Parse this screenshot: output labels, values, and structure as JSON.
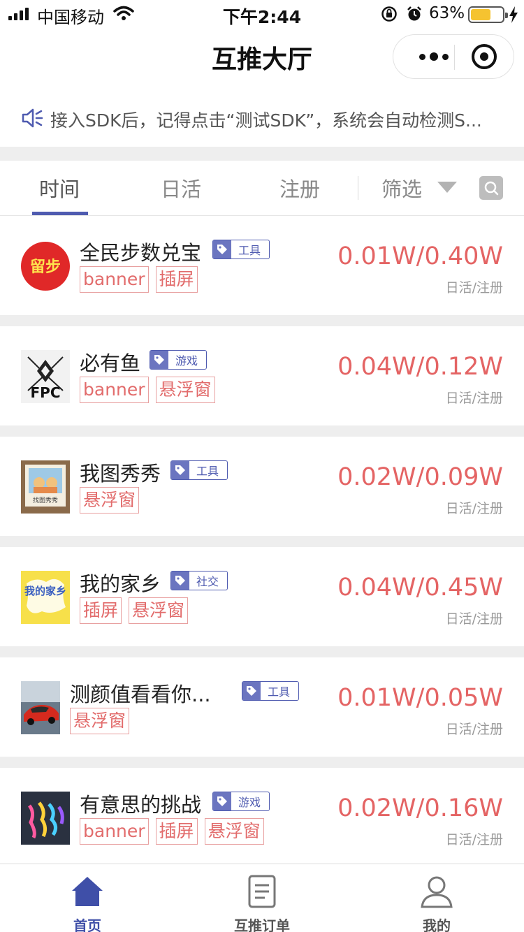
{
  "status_bar": {
    "carrier": "中国移动",
    "time": "下午2:44",
    "battery_percent": "63%",
    "battery_level": 0.63
  },
  "header": {
    "title": "互推大厅"
  },
  "notice": {
    "text": "接入SDK后，记得点击“测试SDK”，系统会自动检测S..."
  },
  "tabs": [
    {
      "label": "时间"
    },
    {
      "label": "日活"
    },
    {
      "label": "注册"
    },
    {
      "label": "筛选"
    }
  ],
  "apps": [
    {
      "name": "全民步数兑宝",
      "category": "工具",
      "tags": [
        "banner",
        "插屏"
      ],
      "stats": "0.01W/0.40W",
      "stats_label": "日活/注册",
      "icon_text": "留步"
    },
    {
      "name": "必有鱼",
      "category": "游戏",
      "tags": [
        "banner",
        "悬浮窗"
      ],
      "stats": "0.04W/0.12W",
      "stats_label": "日活/注册",
      "icon_text": "FPC"
    },
    {
      "name": "我图秀秀",
      "category": "工具",
      "tags": [
        "悬浮窗"
      ],
      "stats": "0.02W/0.09W",
      "stats_label": "日活/注册",
      "icon_text": "找图秀秀"
    },
    {
      "name": "我的家乡",
      "category": "社交",
      "tags": [
        "插屏",
        "悬浮窗"
      ],
      "stats": "0.04W/0.45W",
      "stats_label": "日活/注册",
      "icon_text": "我的家乡"
    },
    {
      "name": "测颜值看看你...",
      "category": "工具",
      "tags": [
        "悬浮窗"
      ],
      "stats": "0.01W/0.05W",
      "stats_label": "日活/注册",
      "icon_text": ""
    },
    {
      "name": "有意思的挑战",
      "category": "游戏",
      "tags": [
        "banner",
        "插屏",
        "悬浮窗"
      ],
      "stats": "0.02W/0.16W",
      "stats_label": "日活/注册",
      "icon_text": ""
    }
  ],
  "tabbar": [
    {
      "label": "首页",
      "icon": "home-icon"
    },
    {
      "label": "互推订单",
      "icon": "document-icon"
    },
    {
      "label": "我的",
      "icon": "user-icon"
    }
  ],
  "colors": {
    "accent": "#4f5bb0",
    "stat_red": "#e46464",
    "tag_red": "#e26c6c"
  }
}
